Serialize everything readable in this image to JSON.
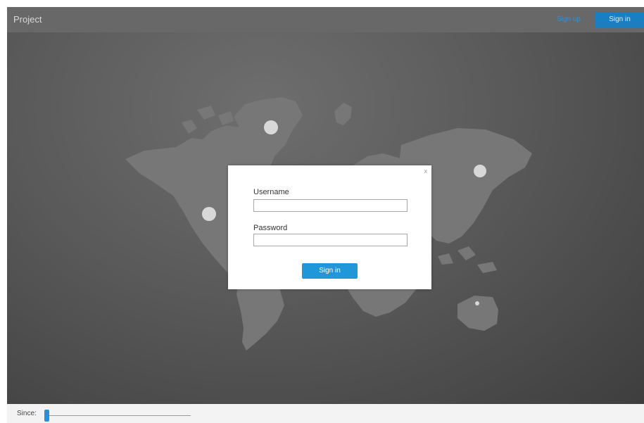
{
  "navbar": {
    "brand": "Project",
    "signup_label": "Sign up",
    "signin_label": "Sign in"
  },
  "modal": {
    "close_label": "x",
    "username_label": "Username",
    "username_value": "",
    "password_label": "Password",
    "password_value": "",
    "submit_label": "Sign in"
  },
  "footer": {
    "since_label": "Since:",
    "slider_value_fraction": 0
  },
  "colors": {
    "accent": "#1f97d9",
    "nav_background": "#686868",
    "map_background": "#5a5a5a",
    "land": "#787878",
    "markers": "#d8d8d8"
  },
  "map": {
    "markers": [
      "north-america-marker",
      "greenland-marker",
      "asia-marker",
      "australia-marker"
    ]
  }
}
